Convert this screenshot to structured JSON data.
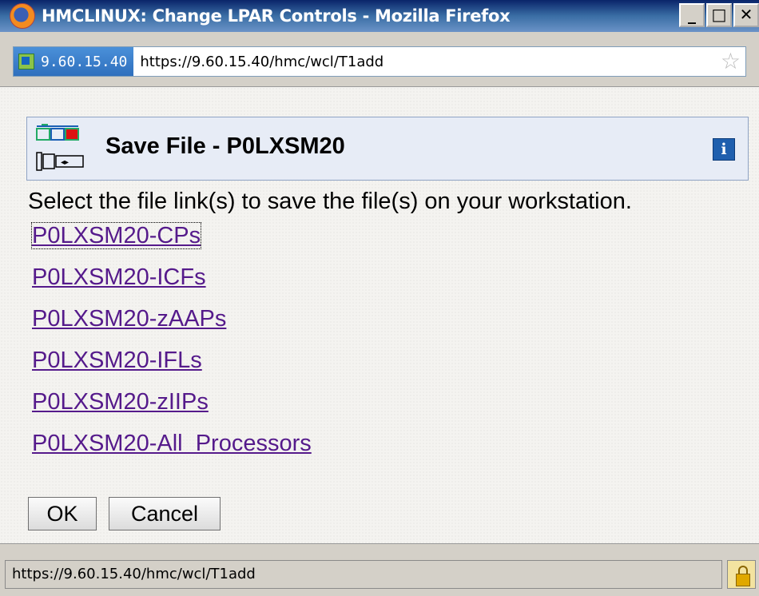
{
  "window": {
    "title": "HMCLINUX: Change LPAR Controls - Mozilla Firefox",
    "controls": {
      "minimize": "_",
      "maximize": "□",
      "close": "✕"
    }
  },
  "addressbar": {
    "site_identity": "9.60.15.40",
    "url": "https://9.60.15.40/hmc/wcl/T1add",
    "bookmark_icon": "star-icon"
  },
  "dialog": {
    "title": "Save File - P0LXSM20",
    "info_label": "i",
    "instructions": "Select the file link(s) to save the file(s) on your workstation.",
    "links": [
      "P0LXSM20-CPs",
      "P0LXSM20-ICFs",
      "P0LXSM20-zAAPs",
      "P0LXSM20-IFLs",
      "P0LXSM20-zIIPs",
      "P0LXSM20-All  Processors"
    ],
    "buttons": {
      "ok": "OK",
      "cancel": "Cancel"
    }
  },
  "statusbar": {
    "text": "https://9.60.15.40/hmc/wcl/T1add",
    "icon": "lock-icon"
  },
  "colors": {
    "title_gradient_start": "#0a246a",
    "link": "#551a8b",
    "header_bg": "#e7ecf6"
  }
}
